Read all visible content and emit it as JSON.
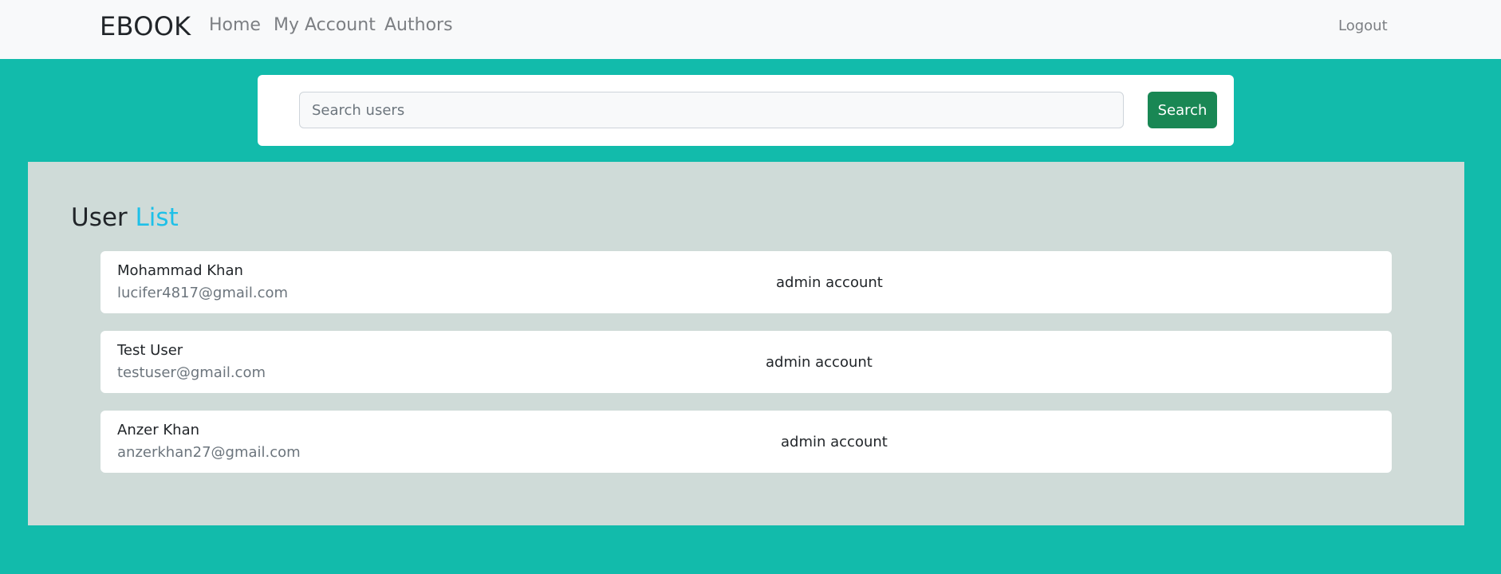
{
  "navbar": {
    "brand": "EBOOK",
    "links": [
      "Home",
      "My Account",
      "Authors"
    ],
    "logout": "Logout"
  },
  "search": {
    "placeholder": "Search users",
    "value": "",
    "button_label": "Search"
  },
  "user_list": {
    "title_prefix": "User",
    "title_accent": "List",
    "users": [
      {
        "name": "Mohammad Khan",
        "email": "lucifer4817@gmail.com",
        "role": "admin account"
      },
      {
        "name": "Test User",
        "email": "testuser@gmail.com",
        "role": "admin account"
      },
      {
        "name": "Anzer Khan",
        "email": "anzerkhan27@gmail.com",
        "role": "admin account"
      }
    ]
  },
  "colors": {
    "page_background": "#12bbab",
    "navbar_background": "#f8f9fa",
    "section_background": "#cfdbd8",
    "accent_text": "#1ec0e8",
    "search_button": "#198754"
  }
}
